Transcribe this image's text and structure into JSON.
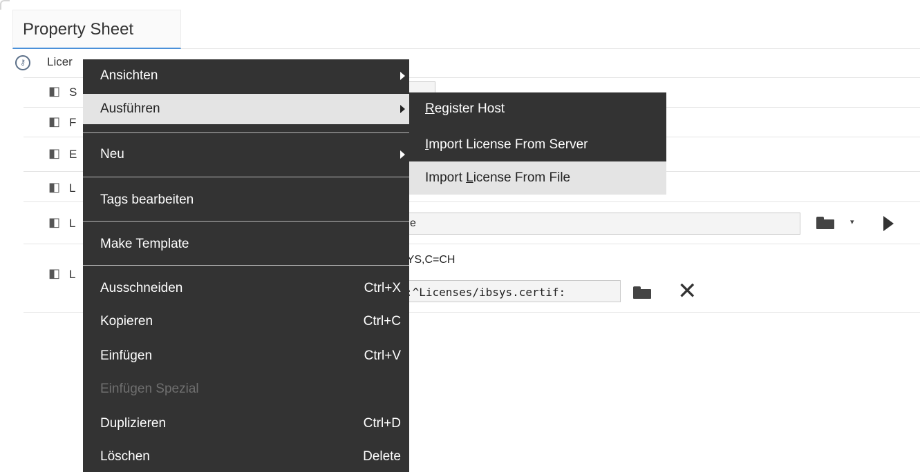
{
  "tab": {
    "label": "Property Sheet"
  },
  "tree": {
    "root_label": "Licer",
    "rows": [
      {
        "label": "S"
      },
      {
        "label": "F"
      },
      {
        "label": "E"
      },
      {
        "label": "L"
      },
      {
        "label": "L"
      },
      {
        "label": "L"
      }
    ]
  },
  "fields": {
    "path_value": "e",
    "subject_value": "SYS,C=CH",
    "certificate_value": ":^Licenses/ibsys.certif:"
  },
  "context_menu": {
    "items": [
      {
        "label": "Ansichten",
        "shortcut": "",
        "submenu": true
      },
      {
        "label": "Ausführen",
        "shortcut": "",
        "submenu": true
      },
      {
        "label": "Neu",
        "shortcut": "",
        "submenu": true
      },
      {
        "label": "Tags bearbeiten",
        "shortcut": ""
      },
      {
        "label": "Make Template",
        "shortcut": ""
      },
      {
        "label": "Ausschneiden",
        "shortcut": "Ctrl+X"
      },
      {
        "label": "Kopieren",
        "shortcut": "Ctrl+C"
      },
      {
        "label": "Einfügen",
        "shortcut": "Ctrl+V"
      },
      {
        "label": "Einfügen Spezial",
        "shortcut": "",
        "disabled": true
      },
      {
        "label": "Duplizieren",
        "shortcut": "Ctrl+D"
      },
      {
        "label": "Löschen",
        "shortcut": "Delete"
      }
    ]
  },
  "submenu": {
    "items": [
      {
        "mnemonic": "R",
        "rest": "egister Host"
      },
      {
        "mnemonic": "I",
        "rest": "mport License From Server"
      },
      {
        "prefix": "Import ",
        "mnemonic": "L",
        "rest": "icense From File"
      }
    ]
  },
  "colors": {
    "menu_bg": "#333333",
    "highlight": "#e4e4e4",
    "tab_accent": "#4a90d9"
  },
  "icons": [
    "component-icon",
    "license-root-icon",
    "folder-icon",
    "play-icon",
    "close-icon",
    "submenu-arrow-icon"
  ]
}
